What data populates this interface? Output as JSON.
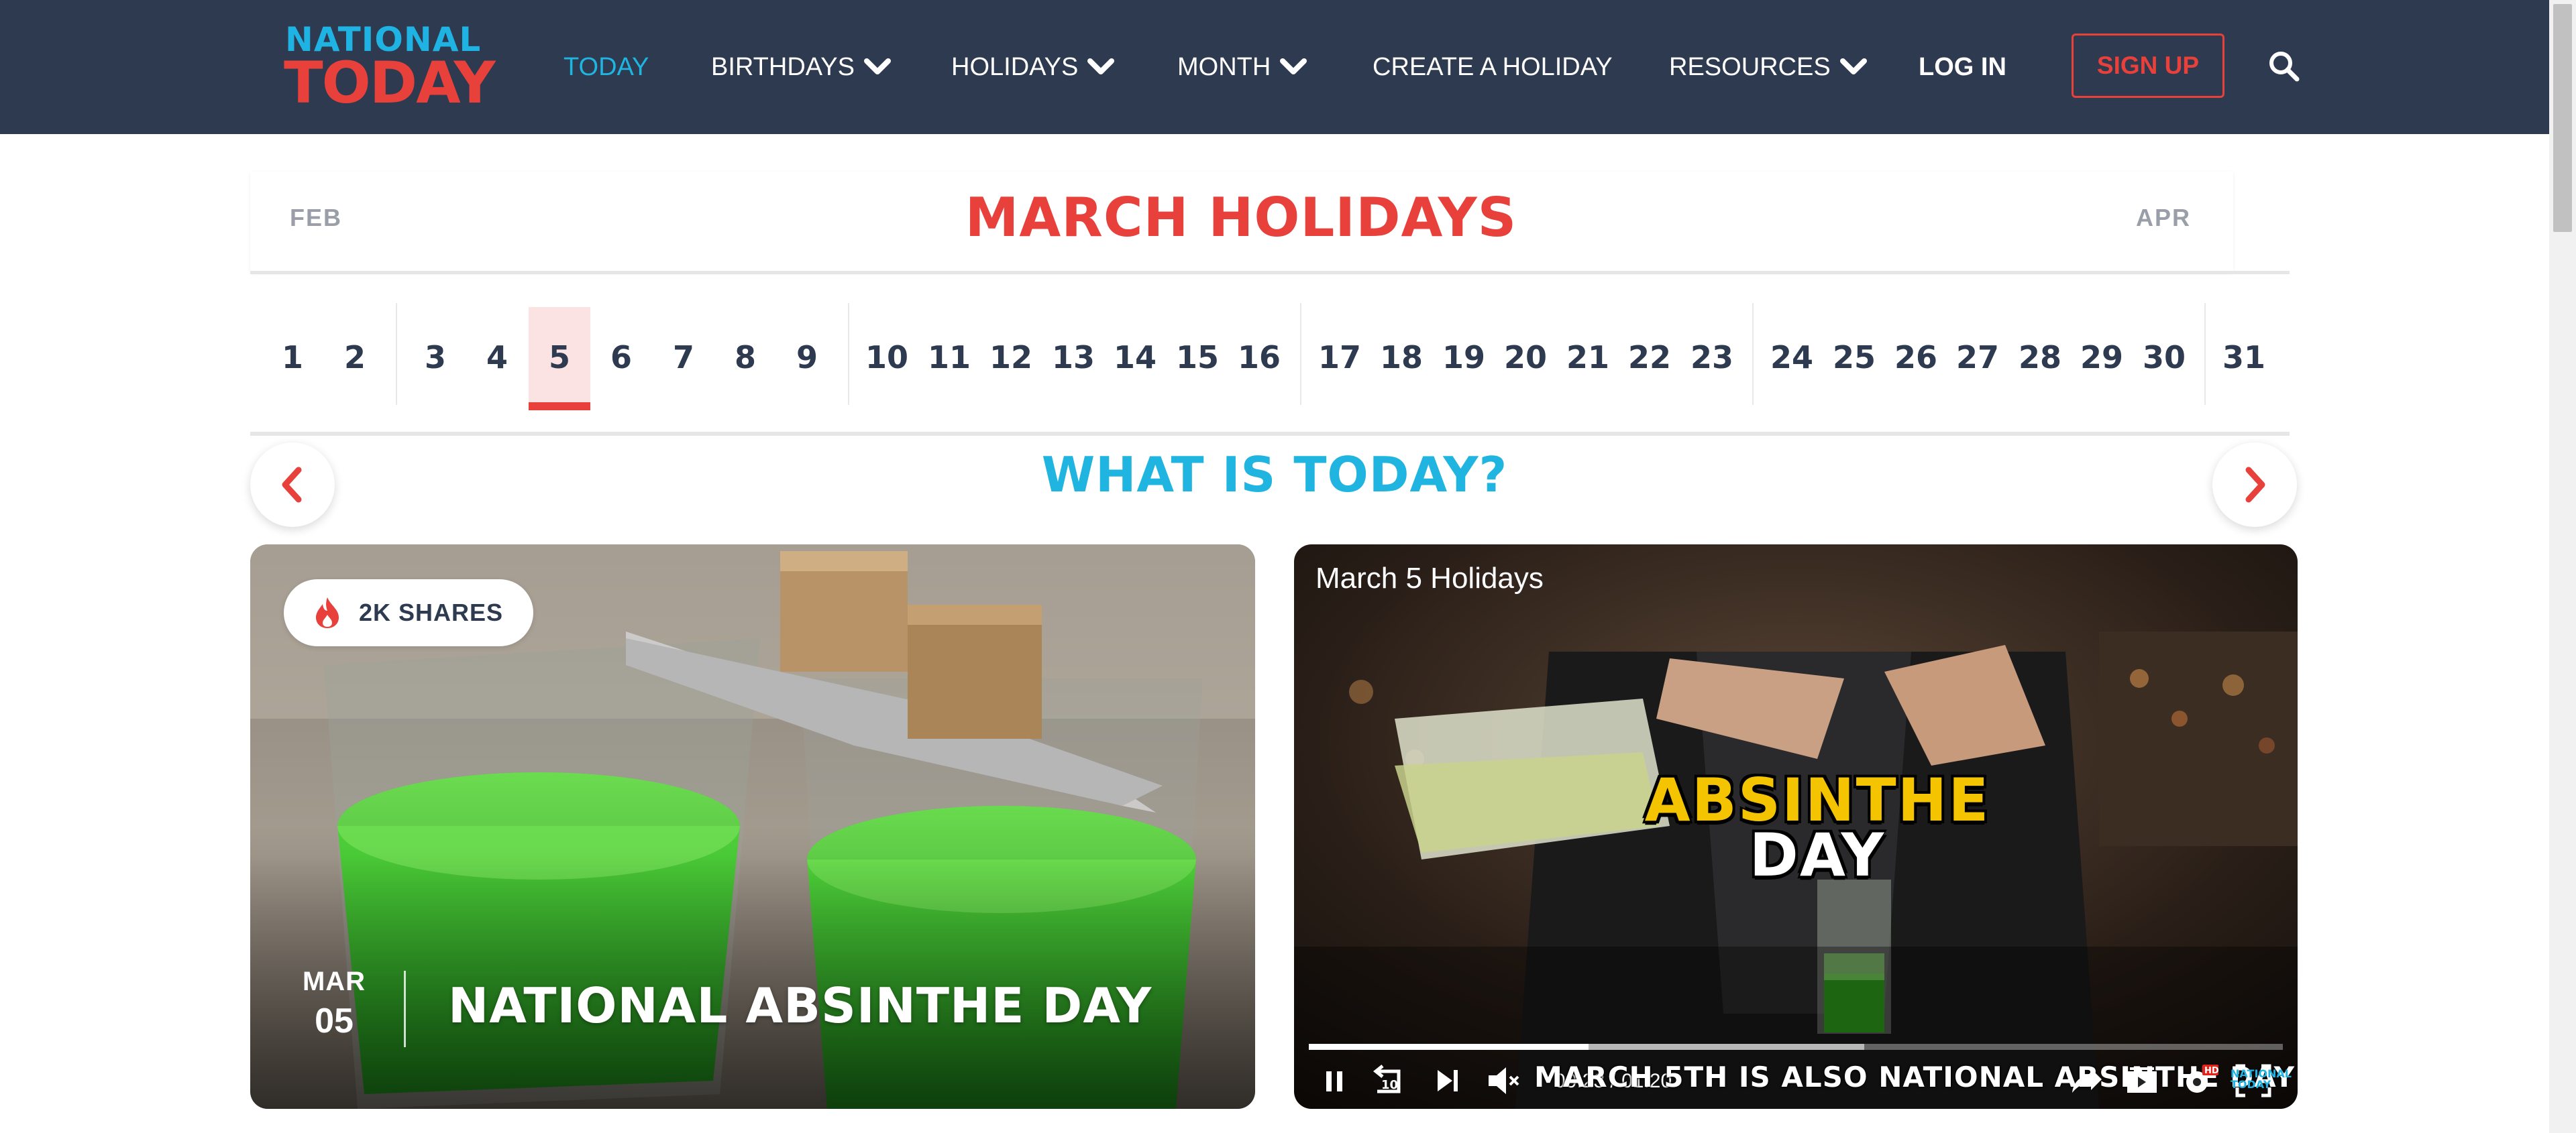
{
  "header": {
    "logo_line1": "NATIONAL",
    "logo_line2": "TODAY",
    "nav": [
      {
        "label": "TODAY",
        "active": true,
        "has_dropdown": false
      },
      {
        "label": "BIRTHDAYS",
        "active": false,
        "has_dropdown": true
      },
      {
        "label": "HOLIDAYS",
        "active": false,
        "has_dropdown": true
      },
      {
        "label": "MONTH",
        "active": false,
        "has_dropdown": true
      },
      {
        "label": "CREATE A HOLIDAY",
        "active": false,
        "has_dropdown": false
      },
      {
        "label": "RESOURCES",
        "active": false,
        "has_dropdown": true
      }
    ],
    "login_label": "LOG IN",
    "signup_label": "SIGN UP",
    "search_icon": "search-icon"
  },
  "calendar": {
    "prev_month": "FEB",
    "title": "MARCH HOLIDAYS",
    "next_month": "APR",
    "days": [
      "1",
      "2",
      "3",
      "4",
      "5",
      "6",
      "7",
      "8",
      "9",
      "10",
      "11",
      "12",
      "13",
      "14",
      "15",
      "16",
      "17",
      "18",
      "19",
      "20",
      "21",
      "22",
      "23",
      "24",
      "25",
      "26",
      "27",
      "28",
      "29",
      "30",
      "31"
    ],
    "selected_day": "5"
  },
  "today_section": {
    "heading": "WHAT IS TODAY?",
    "prev_icon": "chevron-left-icon",
    "next_icon": "chevron-right-icon"
  },
  "feature_card": {
    "shares": "2K SHARES",
    "month": "MAR",
    "day": "05",
    "title": "NATIONAL ABSINTHE DAY"
  },
  "video": {
    "title": "March 5 Holidays",
    "overlay_line1": "ABSINTHE",
    "overlay_line2": "DAY",
    "caption": "MARCH 5TH IS ALSO NATIONAL ABSINTHE DAY",
    "time": "00:23 / 01:20",
    "progress": 0.2875,
    "buffered": 0.57,
    "brand_line1": "NATIONAL",
    "brand_line2": "TODAY",
    "hd_badge": "HD"
  },
  "colors": {
    "nav_bg": "#2d3a4f",
    "accent_red": "#e8403a",
    "accent_blue": "#20b4e0"
  }
}
